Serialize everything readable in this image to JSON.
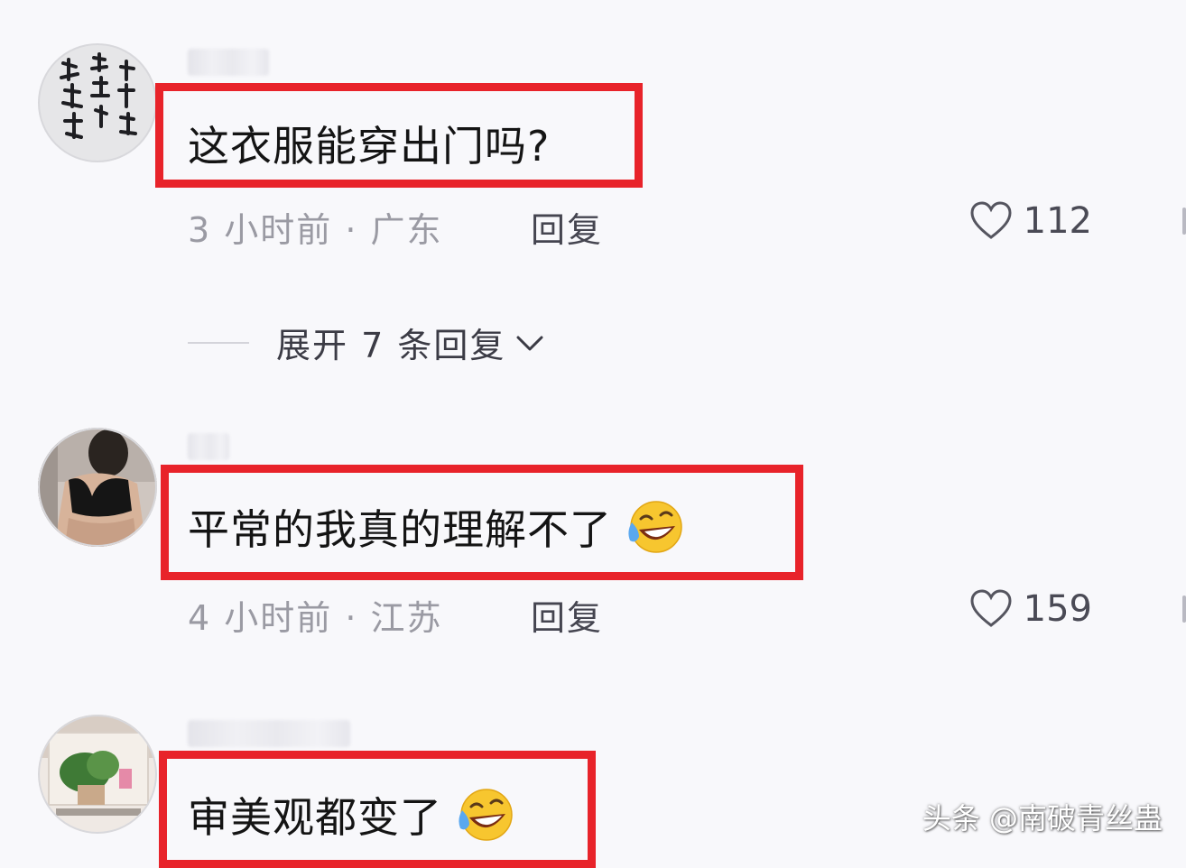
{
  "comments": [
    {
      "text": "这衣服能穿出门吗?",
      "meta": "3 小时前 · 广东",
      "reply_label": "回复",
      "like_count": "112",
      "has_emoji": false
    },
    {
      "text": "平常的我真的理解不了",
      "meta": "4 小时前 · 江苏",
      "reply_label": "回复",
      "like_count": "159",
      "has_emoji": true
    },
    {
      "text": "审美观都变了",
      "has_emoji": true
    }
  ],
  "expand_replies": {
    "label": "展开 7 条回复"
  },
  "watermark": "头条 @南破青丝蛊",
  "colors": {
    "highlight": "#e8232a",
    "background": "#f8f8fb",
    "meta_text": "#9a9aa3"
  },
  "icons": {
    "like": "heart-outline-icon",
    "expand": "chevron-down-icon",
    "emoji": "laughing-crying-emoji-icon"
  }
}
